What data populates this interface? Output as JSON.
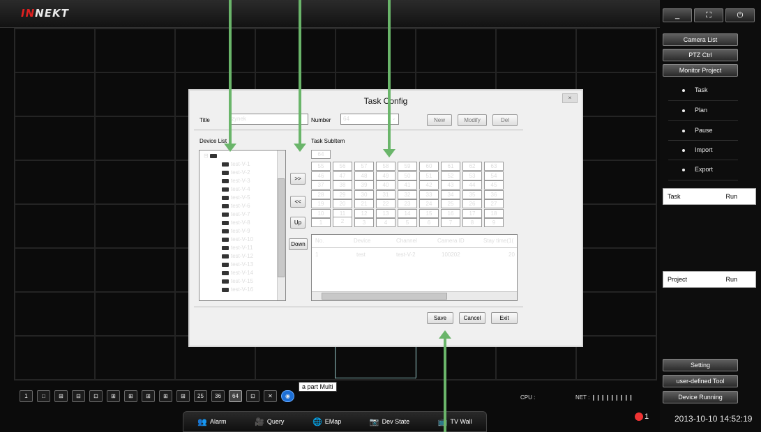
{
  "app": {
    "logo_prefix": "IN",
    "logo_suffix": "NEKT"
  },
  "window_buttons": [
    "_",
    "⛶",
    "⏻"
  ],
  "right_menu": {
    "buttons": [
      "Camera List",
      "PTZ Ctrl",
      "Monitor Project"
    ],
    "items": [
      "Task",
      "Plan",
      "Pause",
      "Import",
      "Export"
    ],
    "task_bar": {
      "label": "Task",
      "action": "Run"
    },
    "project_bar": {
      "label": "Project",
      "action": "Run"
    },
    "bottom_buttons": [
      "Setting",
      "user-defined Tool",
      "Device Running"
    ]
  },
  "toolbar": {
    "buttons": [
      "1",
      "□",
      "⊞",
      "⊟",
      "⊡",
      "⊞",
      "⊞",
      "⊞",
      "⊞",
      "⊞",
      "25",
      "36",
      "64",
      "⊡",
      "✕"
    ],
    "tooltip": "a part Multi"
  },
  "status": {
    "cpu": "CPU :",
    "net": "NET : ❙❙❙❙❙❙❙❙❙"
  },
  "tabs": [
    {
      "icon": "👥",
      "label": "Alarm"
    },
    {
      "icon": "🎥",
      "label": "Query"
    },
    {
      "icon": "🌐",
      "label": "EMap"
    },
    {
      "icon": "📷",
      "label": "Dev State"
    },
    {
      "icon": "📺",
      "label": "TV Wall"
    }
  ],
  "alarm_count": "1",
  "clock": "2013-10-10 14:52:19",
  "dialog": {
    "title": "Task Config",
    "close": "×",
    "title_label": "Title",
    "title_value": "zynek",
    "number_label": "Number",
    "number_value": "64",
    "new_btn": "New",
    "modify_btn": "Modify",
    "del_btn": "Del",
    "device_list_label": "Device List",
    "task_subitem_label": "Task SubItem",
    "devices": [
      "test-V-1",
      "test-V-2",
      "test-V-3",
      "test-V-4",
      "test-V-5",
      "test-V-6",
      "test-V-7",
      "test-V-8",
      "test-V-9",
      "test-V-10",
      "test-V-11",
      "test-V-12",
      "test-V-13",
      "test-V-14",
      "test-V-15",
      "test-V-16"
    ],
    "move_buttons": [
      ">>",
      "<<",
      "Up",
      "Down"
    ],
    "subitem_grid": [
      [
        "64"
      ],
      [
        "55",
        "56",
        "57",
        "58",
        "59",
        "60",
        "61",
        "62",
        "63"
      ],
      [
        "46",
        "47",
        "48",
        "49",
        "50",
        "51",
        "52",
        "53",
        "54"
      ],
      [
        "37",
        "38",
        "39",
        "40",
        "41",
        "42",
        "43",
        "44",
        "45"
      ],
      [
        "28",
        "29",
        "30",
        "31",
        "32",
        "33",
        "34",
        "35",
        "36"
      ],
      [
        "19",
        "20",
        "21",
        "22",
        "23",
        "24",
        "25",
        "26",
        "27"
      ],
      [
        "10",
        "11",
        "12",
        "13",
        "14",
        "15",
        "16",
        "17",
        "18"
      ],
      [
        "1",
        "2",
        "3",
        "4",
        "5",
        "6",
        "7",
        "8",
        "9"
      ]
    ],
    "table_headers": [
      "No.",
      "Device",
      "Channel",
      "Camera ID",
      "Stay time(1("
    ],
    "table_rows": [
      [
        "1",
        "test",
        "test-V-2",
        "100202",
        "20"
      ]
    ],
    "save_btn": "Save",
    "cancel_btn": "Cancel",
    "exit_btn": "Exit"
  }
}
